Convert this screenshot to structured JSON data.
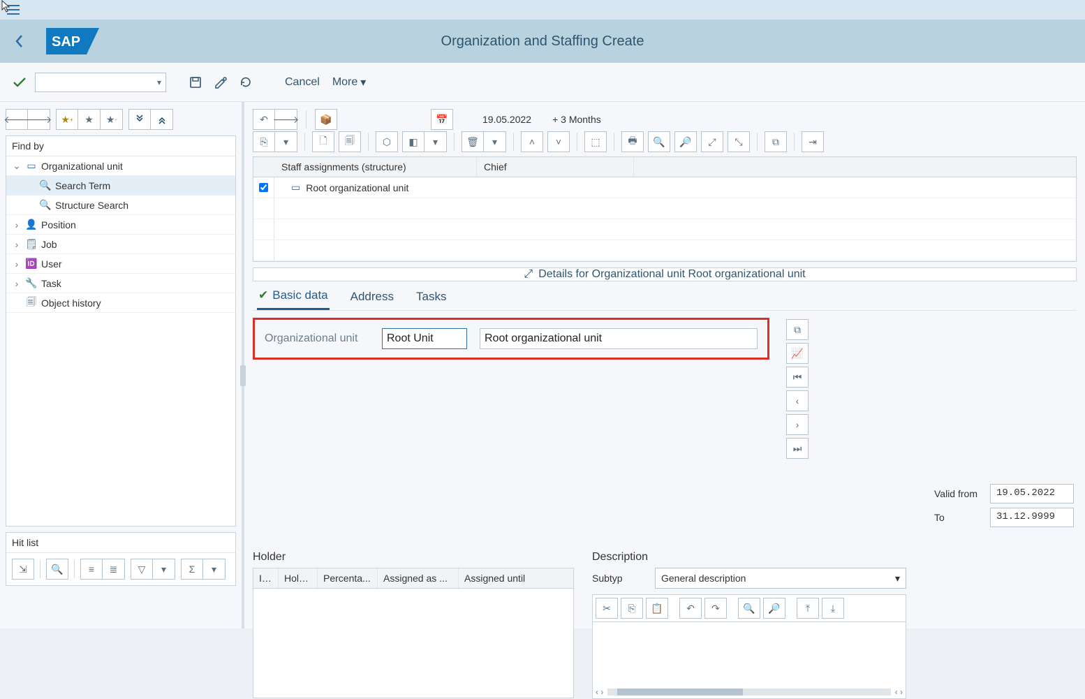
{
  "menu_bar": {},
  "shell": {
    "title": "Organization and Staffing Create"
  },
  "app_toolbar": {
    "cancel": "Cancel",
    "more": "More"
  },
  "findby": {
    "header": "Find by",
    "items": {
      "org_unit": "Organizational unit",
      "search_term": "Search Term",
      "structure_search": "Structure Search",
      "position": "Position",
      "job": "Job",
      "user": "User",
      "task": "Task",
      "object_history": "Object history"
    }
  },
  "hitlist": {
    "header": "Hit list"
  },
  "right": {
    "date": "19.05.2022",
    "date_suffix": "+ 3 Months",
    "grid_cols": {
      "staff": "Staff assignments (structure)",
      "chief": "Chief"
    },
    "grid_row1": "Root organizational unit",
    "details_bar": "Details for Organizational unit Root organizational unit",
    "tabs": {
      "basic": "Basic data",
      "address": "Address",
      "tasks": "Tasks"
    },
    "org_label": "Organizational unit",
    "org_short": "Root Unit",
    "org_long": "Root organizational unit",
    "valid_from_label": "Valid from",
    "valid_from": "19.05.2022",
    "valid_to_label": "To",
    "valid_to": "31.12.9999",
    "holder": {
      "title": "Holder",
      "cols": {
        "icon": "Ic...",
        "holder": "Holder",
        "percent": "Percenta...",
        "assigned_as": "Assigned as ...",
        "assigned_until": "Assigned until"
      }
    },
    "description": {
      "title": "Description",
      "subtyp_label": "Subtyp",
      "subtyp_value": "General description"
    }
  }
}
